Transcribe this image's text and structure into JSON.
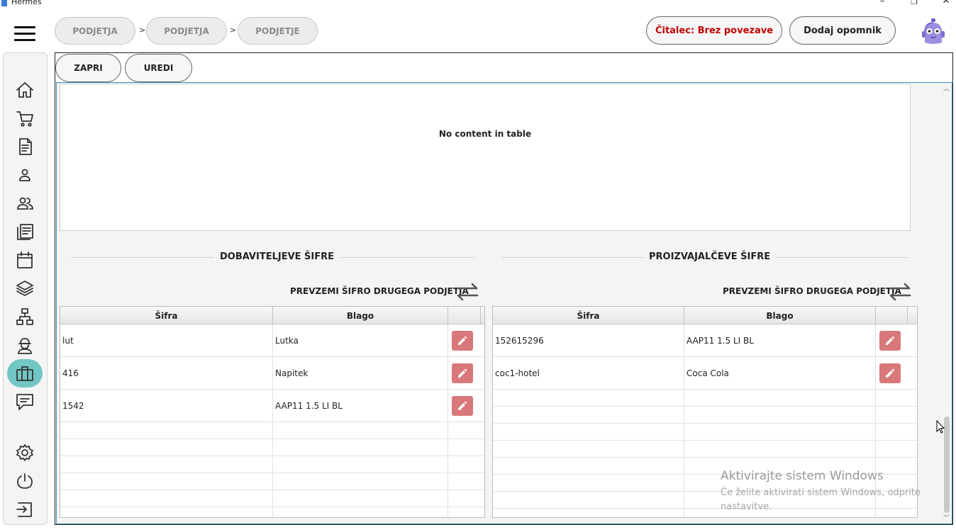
{
  "window": {
    "title": "Hermes",
    "minimize": "–",
    "maximize": "❐",
    "close": "✕"
  },
  "breadcrumbs": [
    {
      "label": "PODJETJA"
    },
    {
      "label": "PODJETJA"
    },
    {
      "label": "PODJETJE"
    }
  ],
  "breadcrumb_separator": ">",
  "header": {
    "reader_status": "Čitalec: Brez povezave",
    "reader_status_color": "#c00000",
    "add_reminder": "Dodaj opomnik"
  },
  "sidebar": {
    "items": [
      {
        "icon": "home-icon"
      },
      {
        "icon": "cart-icon"
      },
      {
        "icon": "document-icon"
      },
      {
        "icon": "person-icon"
      },
      {
        "icon": "people-icon"
      },
      {
        "icon": "list-icon"
      },
      {
        "icon": "calendar-icon"
      },
      {
        "icon": "layers-icon"
      },
      {
        "icon": "network-icon"
      },
      {
        "icon": "worker-icon"
      },
      {
        "icon": "briefcase-icon",
        "active": true
      },
      {
        "icon": "chat-icon"
      },
      {
        "icon": "settings-icon"
      },
      {
        "icon": "power-icon"
      },
      {
        "icon": "logout-icon"
      }
    ],
    "active_color": "#72c6c4"
  },
  "toolbar": {
    "close_label": "ZAPRI",
    "edit_label": "UREDI"
  },
  "top_table": {
    "empty_message": "No content in table"
  },
  "supplier_codes": {
    "title": "DOBAVITELJEVE ŠIFRE",
    "take_over": "PREVZEMI ŠIFRO DRUGEGA PODJETJA",
    "columns": [
      "Šifra",
      "Blago"
    ],
    "rows": [
      {
        "code": "lut",
        "item": "Lutka"
      },
      {
        "code": "416",
        "item": "Napitek"
      },
      {
        "code": "1542",
        "item": "AAP11 1.5 LI BL"
      }
    ]
  },
  "manufacturer_codes": {
    "title": "PROIZVAJALČEVE ŠIFRE",
    "take_over": "PREVZEMI ŠIFRO DRUGEGA PODJETJA",
    "columns": [
      "Šifra",
      "Blago"
    ],
    "rows": [
      {
        "code": "152615296",
        "item": "AAP11 1.5 LI BL"
      },
      {
        "code": "coc1-hotel",
        "item": "Coca Cola"
      }
    ]
  },
  "edit_button_color": "#d9787a",
  "watermark": {
    "line1": "Aktivirajte sistem Windows",
    "line2": "Če želite aktivirati sistem Windows, odprite nastavitve."
  }
}
